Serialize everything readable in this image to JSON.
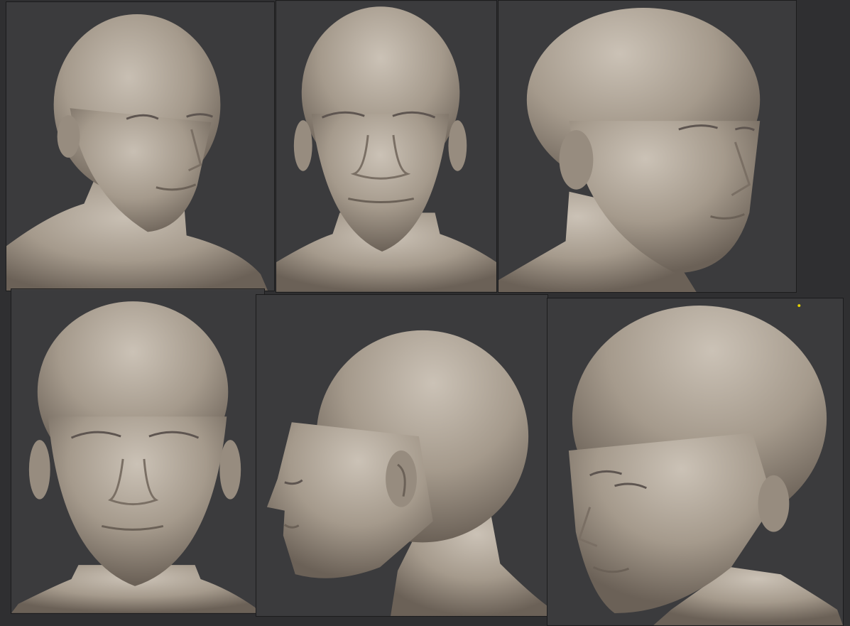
{
  "sheet": {
    "background_color": "#2f2f31",
    "panel_background_color": "#3b3b3d",
    "clay_color": "#a59a8c",
    "clay_highlight_color": "#c8bfb3",
    "clay_shadow_color": "#6b6157",
    "marker_color": "#e6d200",
    "views": [
      {
        "view": "three-quarter-left"
      },
      {
        "view": "front-upper"
      },
      {
        "view": "three-quarter-right"
      },
      {
        "view": "front-lower"
      },
      {
        "view": "side-profile-left"
      },
      {
        "view": "three-quarter-low-angle"
      }
    ]
  }
}
